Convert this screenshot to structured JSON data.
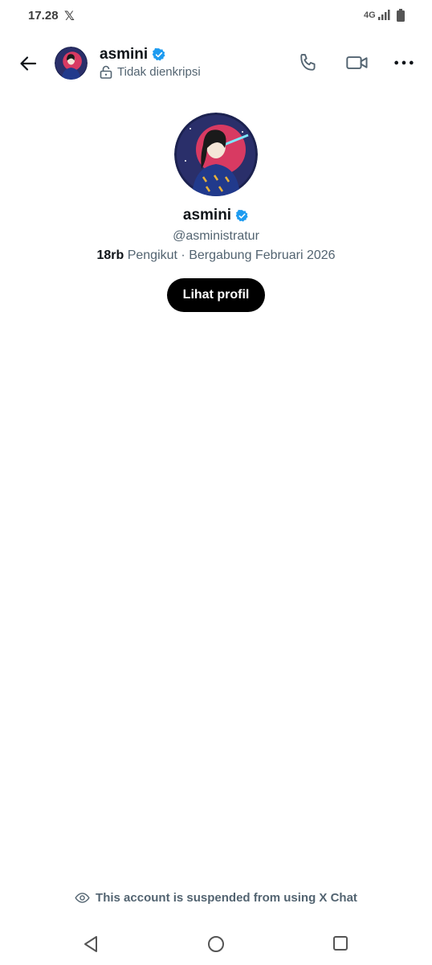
{
  "status_bar": {
    "time": "17.28",
    "app_icon": "x-logo",
    "network": "4G",
    "signal_icon": "signal-icon",
    "battery_icon": "battery-icon"
  },
  "header": {
    "name": "asmini",
    "encryption_label": "Tidak dienkripsi",
    "icons": [
      "back-arrow-icon",
      "phone-icon",
      "video-icon",
      "more-icon"
    ]
  },
  "profile": {
    "name": "asmini",
    "handle": "@asministratur",
    "followers_count": "18rb",
    "followers_label": "Pengikut · Bergabung Februari 2026",
    "view_profile_label": "Lihat profil"
  },
  "notice": {
    "text": "This account is suspended from using X Chat",
    "icon": "eye-icon"
  },
  "colors": {
    "accent": "#1d9bf0",
    "text": "#0f1419",
    "secondary": "#536471",
    "button_bg": "#000000"
  }
}
